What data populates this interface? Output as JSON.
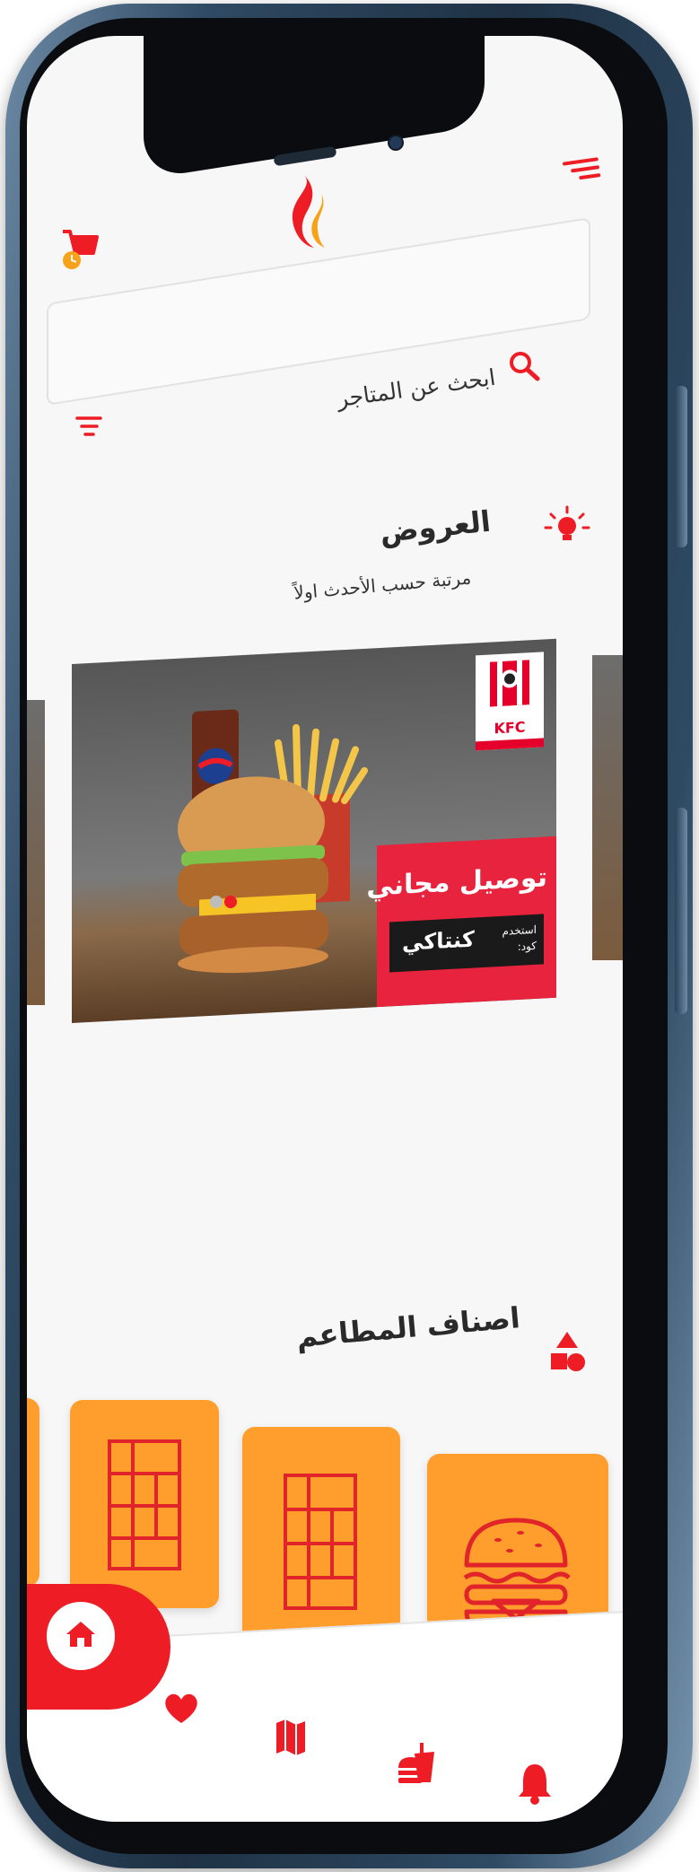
{
  "header": {
    "menu_icon": "menu-lines-icon",
    "logo_icon": "flame-logo-icon",
    "cart_icon": "cart-clock-icon"
  },
  "search": {
    "placeholder": "ابحث  عن المتاجر",
    "search_icon": "search-icon",
    "filter_icon": "filter-icon"
  },
  "offers": {
    "icon": "lightbulb-icon",
    "title": "العروض",
    "subtitle": "مرتبة حسب الأحدث اولاً"
  },
  "banner": {
    "brand": "KFC",
    "headline": "توصيل مجاني",
    "code_label": "استخدم كود:",
    "code": "كنتاكي",
    "active_index": 0,
    "dot_count": 2
  },
  "categories": {
    "icon": "shapes-icon",
    "title": "اصناف المطاعم",
    "items": [
      {
        "icon": "burger-icon"
      },
      {
        "icon": "grid-window-icon"
      },
      {
        "icon": "grid-window-icon"
      }
    ]
  },
  "nav": {
    "items": [
      {
        "icon": "home-icon",
        "active": true
      },
      {
        "icon": "heart-icon"
      },
      {
        "icon": "map-icon"
      },
      {
        "icon": "food-icon"
      },
      {
        "icon": "bell-icon"
      }
    ]
  },
  "colors": {
    "accent": "#ee1c25",
    "category_bg": "#ff9e2c",
    "logo_orange": "#f7a21b"
  }
}
